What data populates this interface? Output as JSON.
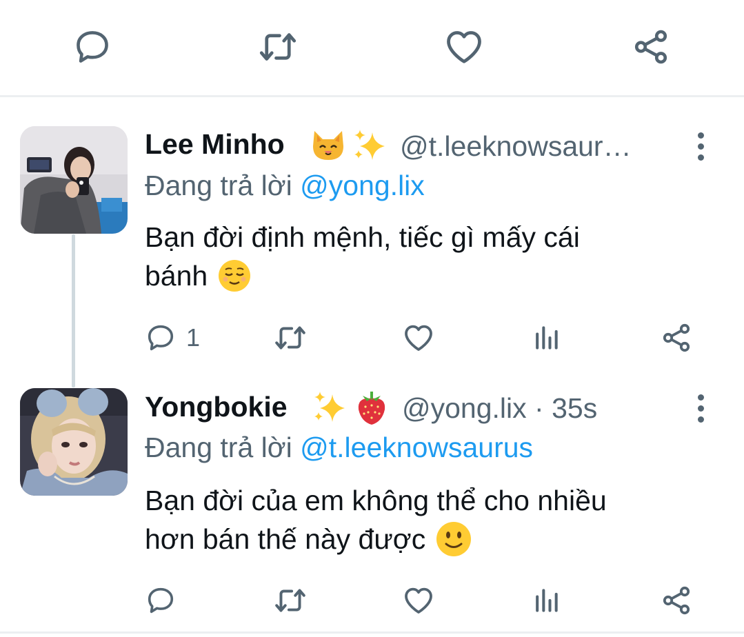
{
  "top_actions": [
    "reply-icon",
    "retweet-icon",
    "like-icon",
    "share-icon"
  ],
  "tweets": [
    {
      "name": "Lee Minho",
      "name_emojis": [
        "cat-face-emoji",
        "sparkles-emoji"
      ],
      "handle": "@t.leeknowsaur…",
      "timestamp": "",
      "replying_prefix": "Đang trả lời",
      "replying_to": "@yong.lix",
      "text_lines": [
        "Bạn đời định mệnh, tiếc gì mấy cái",
        "bánh"
      ],
      "text_emoji": "relieved-face-emoji",
      "reply_count": "1"
    },
    {
      "name": "Yongbokie",
      "name_emojis": [
        "sparkles-emoji",
        "strawberry-emoji"
      ],
      "handle": "@yong.lix",
      "timestamp": "· 35s",
      "replying_prefix": "Đang trả lời",
      "replying_to": "@t.leeknowsaurus",
      "text_lines": [
        "Bạn đời của em không thể cho nhiều",
        "hơn bán thế này được"
      ],
      "text_emoji": "slightly-smiling-face-emoji",
      "reply_count": ""
    }
  ],
  "colors": {
    "icon_gray": "#536471",
    "link_blue": "#1d9bf0",
    "separator": "#eceff1",
    "text": "#0f1419"
  }
}
